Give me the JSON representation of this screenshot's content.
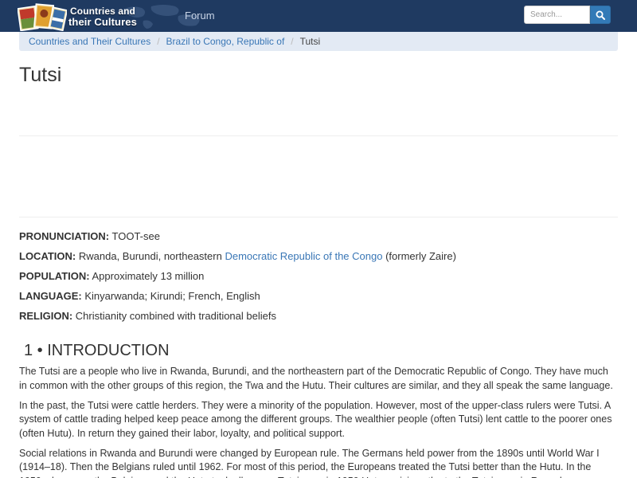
{
  "header": {
    "brand_line1": "Countries and",
    "brand_line2": "their Cultures",
    "nav_forum": "Forum",
    "search_placeholder": "Search...",
    "colors": {
      "navbar": "#1f3a61",
      "search_button": "#337ab7",
      "link": "#3a77b6"
    }
  },
  "breadcrumb": {
    "items": [
      "Countries and Their Cultures",
      "Brazil to Congo, Republic of"
    ],
    "current": "Tutsi",
    "separator": "/"
  },
  "page": {
    "title": "Tutsi"
  },
  "facts": {
    "pronunciation": {
      "label": "PRONUNCIATION:",
      "value": "TOOT-see"
    },
    "location": {
      "label": "LOCATION:",
      "pre": "Rwanda, Burundi, northeastern",
      "link": "Democratic Republic of the Congo",
      "post": "(formerly Zaire)"
    },
    "population": {
      "label": "POPULATION:",
      "value": "Approximately 13 million"
    },
    "language": {
      "label": "LANGUAGE:",
      "value": "Kinyarwanda; Kirundi; French, English"
    },
    "religion": {
      "label": "RELIGION:",
      "value": "Christianity combined with traditional beliefs"
    }
  },
  "section": {
    "heading": "1 • INTRODUCTION",
    "paragraphs": [
      "The Tutsi are a people who live in Rwanda, Burundi, and the northeastern part of the Democratic Republic of Congo. They have much in common with the other groups of this region, the Twa and the Hutu. Their cultures are similar, and they all speak the same language.",
      "In the past, the Tutsi were cattle herders. They were a minority of the population. However, most of the upper-class rulers were Tutsi. A system of cattle trading helped keep peace among the different groups. The wealthier people (often Tutsi) lent cattle to the poorer ones (often Hutu). In return they gained their labor, loyalty, and political support.",
      "Social relations in Rwanda and Burundi were changed by European rule. The Germans held power from the 1890s until World War I (1914–18). Then the Belgians ruled until 1962. For most of this period, the Europeans treated the Tutsi better than the Hutu. In the 1950s, however, the Belgians and the Hutu took all power. Tutsi were in 1959 Hutu uprisings the to the Tutsi were in Rwanda"
    ]
  }
}
